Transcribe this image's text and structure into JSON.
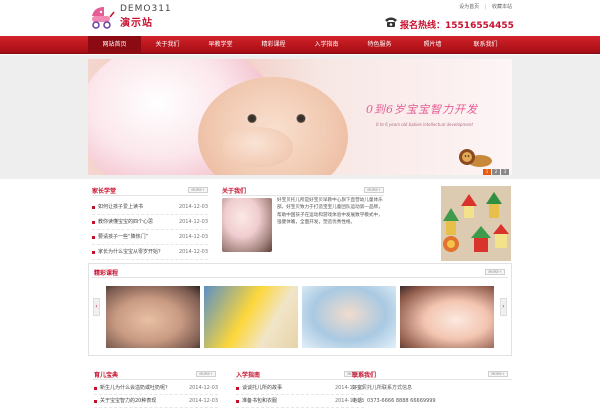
{
  "header": {
    "logo_en": "DEMO311",
    "logo_cn": "演示站",
    "toplinks": [
      "设为首页",
      "收藏本站"
    ],
    "hotline_label": "报名热线：",
    "hotline_number": "15516554455"
  },
  "nav": {
    "items": [
      "网站首页",
      "关于我们",
      "早教学堂",
      "精彩课程",
      "入学指南",
      "特色服务",
      "照片墙",
      "联系我们"
    ]
  },
  "banner": {
    "slogan": "0到6岁宝宝智力开发",
    "sub": "0 to 6 years old babies intellectual development",
    "dots": [
      "1",
      "2",
      "3"
    ]
  },
  "news": {
    "title": "家长学堂",
    "more": "MORE+",
    "items": [
      {
        "title": "如何让孩子爱上读书",
        "date": "2014-12-03"
      },
      {
        "title": "教你读懂宝宝的四个心思",
        "date": "2014-12-03"
      },
      {
        "title": "要请孩子一些“降热门”",
        "date": "2014-12-03"
      },
      {
        "title": "家长为什么宝宝从零岁开始？",
        "date": "2014-12-03"
      }
    ]
  },
  "about": {
    "title": "关于我们",
    "more": "MORE+",
    "text": "好宝贝托儿所是好宝贝早教中心旗下直营幼儿童体乐部。好宝贝致力于打造宝宝儿童团队运动第一品牌，帮助中国孩子在运动和游戏体验中发展数学模式中，强健体魄，全面开发，塑造优秀性格。"
  },
  "courses": {
    "title": "精彩课程",
    "more": "MORE+"
  },
  "bottom": {
    "col1": {
      "title": "育儿宝典",
      "more": "MORE+",
      "items": [
        {
          "title": "新生儿为什么会溢奶或吐奶呢？",
          "date": "2014-12-03"
        },
        {
          "title": "关于宝宝智力的20种表现",
          "date": "2014-12-03"
        }
      ]
    },
    "col2": {
      "title": "入学指南",
      "more": "MORE+",
      "items": [
        {
          "title": "谈谈托儿所的故事",
          "date": "2014-12-03"
        },
        {
          "title": "准备书包和衣服",
          "date": "2014-12-03"
        }
      ]
    },
    "col3": {
      "title": "联系我们",
      "more": "MORE+",
      "line1": "好宝贝托儿所联系方式信息",
      "line2": "电话：0373-6666 8888  66669999"
    }
  }
}
